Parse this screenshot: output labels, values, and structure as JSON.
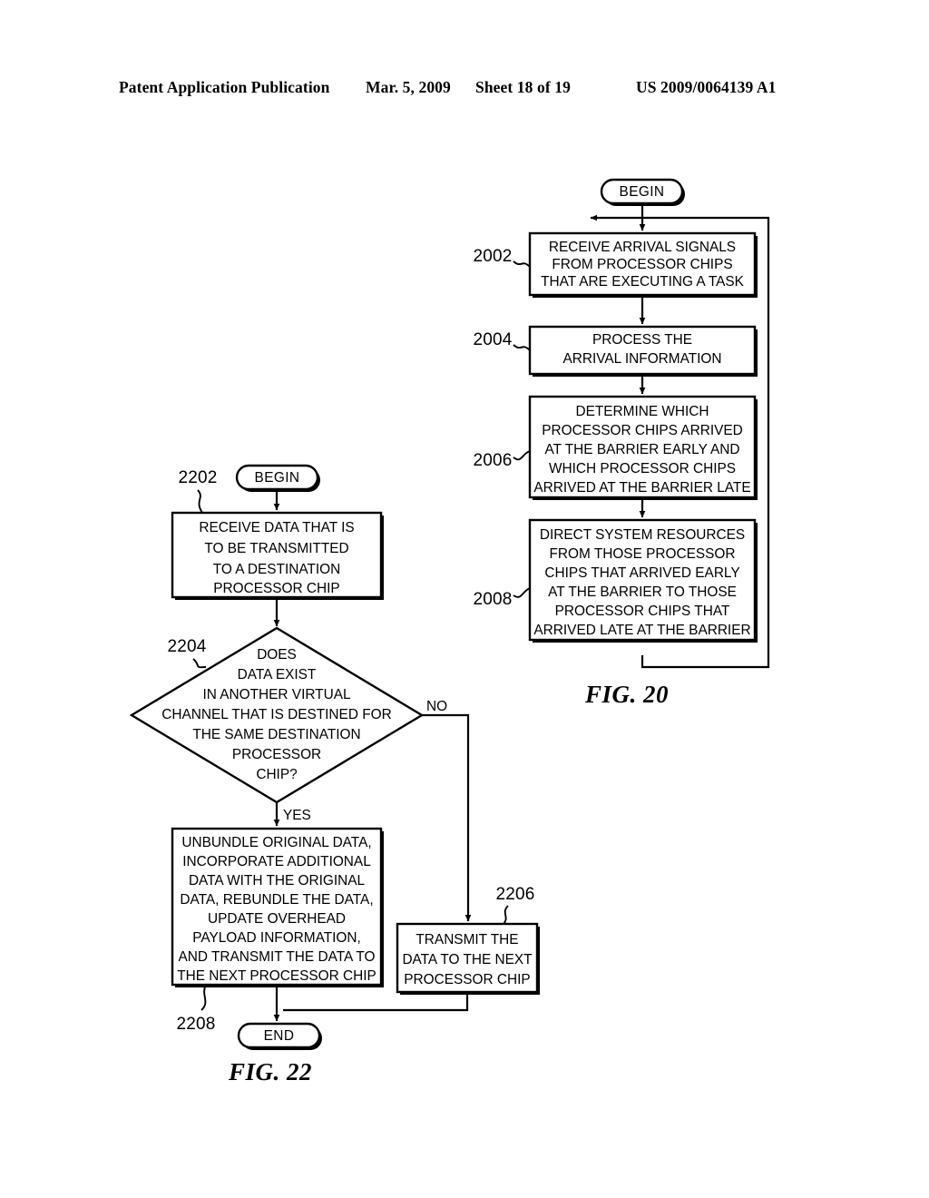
{
  "header": {
    "publication": "Patent Application Publication",
    "date": "Mar. 5, 2009",
    "sheet": "Sheet 18 of 19",
    "patent_number": "US 2009/0064139 A1"
  },
  "figures": [
    {
      "id": "fig20",
      "caption": "FIG. 20",
      "nodes": {
        "begin": {
          "ref": "",
          "label": "BEGIN"
        },
        "n2002": {
          "ref": "2002",
          "lines": [
            "RECEIVE ARRIVAL SIGNALS",
            "FROM PROCESSOR CHIPS",
            "THAT ARE EXECUTING A TASK"
          ]
        },
        "n2004": {
          "ref": "2004",
          "lines": [
            "PROCESS THE",
            "ARRIVAL INFORMATION"
          ]
        },
        "n2006": {
          "ref": "2006",
          "lines": [
            "DETERMINE WHICH",
            "PROCESSOR CHIPS ARRIVED",
            "AT THE BARRIER EARLY AND",
            "WHICH PROCESSOR CHIPS",
            "ARRIVED AT THE BARRIER LATE"
          ]
        },
        "n2008": {
          "ref": "2008",
          "lines": [
            "DIRECT SYSTEM RESOURCES",
            "FROM THOSE PROCESSOR",
            "CHIPS THAT ARRIVED EARLY",
            "AT THE BARRIER TO THOSE",
            "PROCESSOR CHIPS THAT",
            "ARRIVED LATE AT THE BARRIER"
          ]
        }
      }
    },
    {
      "id": "fig22",
      "caption": "FIG. 22",
      "nodes": {
        "begin": {
          "ref": "",
          "label": "BEGIN"
        },
        "n2202": {
          "ref": "2202",
          "lines": [
            "RECEIVE DATA THAT IS",
            "TO BE TRANSMITTED",
            "TO A DESTINATION",
            "PROCESSOR CHIP"
          ]
        },
        "n2204": {
          "ref": "2204",
          "lines": [
            "DOES",
            "DATA EXIST",
            "IN ANOTHER VIRTUAL",
            "CHANNEL THAT IS DESTINED FOR",
            "THE SAME DESTINATION",
            "PROCESSOR",
            "CHIP?"
          ],
          "branch_yes": "YES",
          "branch_no": "NO"
        },
        "n2208": {
          "ref": "2208",
          "lines": [
            "UNBUNDLE ORIGINAL DATA,",
            "INCORPORATE ADDITIONAL",
            "DATA WITH THE ORIGINAL",
            "DATA, REBUNDLE THE DATA,",
            "UPDATE OVERHEAD",
            "PAYLOAD INFORMATION,",
            "AND TRANSMIT THE DATA TO",
            "THE NEXT PROCESSOR CHIP"
          ]
        },
        "n2206": {
          "ref": "2206",
          "lines": [
            "TRANSMIT THE",
            "DATA TO THE NEXT",
            "PROCESSOR CHIP"
          ]
        },
        "end": {
          "ref": "",
          "label": "END"
        }
      }
    }
  ],
  "colors": {
    "ink": "#000000",
    "paper": "#ffffff"
  }
}
